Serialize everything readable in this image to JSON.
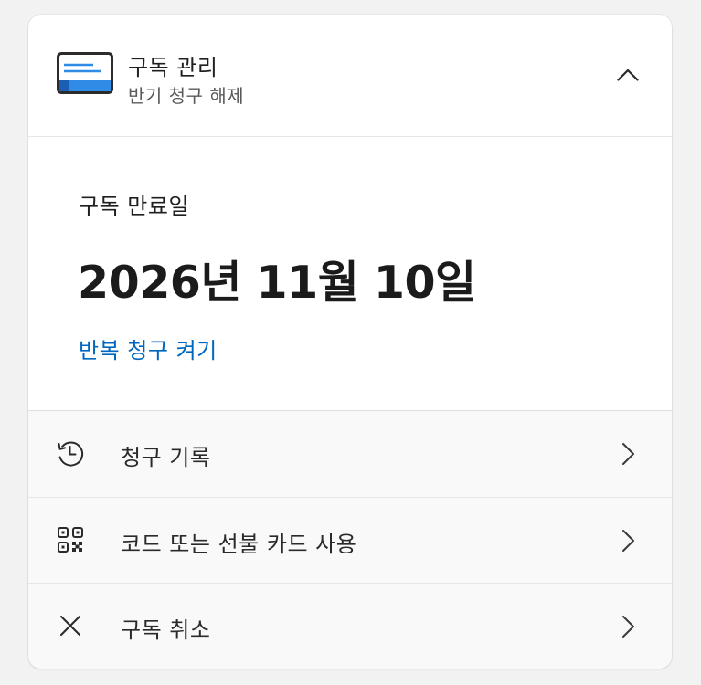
{
  "colors": {
    "accent": "#0067c0",
    "icon_blue": "#2f8be6",
    "text_primary": "#1b1b1b",
    "text_secondary": "#5a5a5a",
    "page_background": "#f2f2f2",
    "actions_background": "#f9f9f9"
  },
  "header": {
    "icon": "card-icon",
    "title": "구독 관리",
    "subtitle": "반기 청구 해제",
    "collapse_icon": "chevron-up-icon"
  },
  "subscription": {
    "expiry_label": "구독 만료일",
    "expiry_date": "2026년 11월 10일",
    "renew_link": "반복 청구 켜기"
  },
  "actions": [
    {
      "icon": "history-icon",
      "label": "청구 기록",
      "chevron": "chevron-right-icon"
    },
    {
      "icon": "qr-code-icon",
      "label": "코드 또는 선불 카드 사용",
      "chevron": "chevron-right-icon"
    },
    {
      "icon": "close-icon",
      "label": "구독 취소",
      "chevron": "chevron-right-icon"
    }
  ]
}
